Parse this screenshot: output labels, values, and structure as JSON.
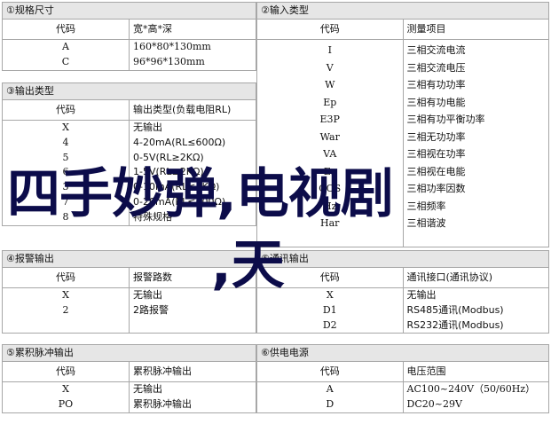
{
  "sections": {
    "s1": {
      "title": "①规格尺寸",
      "col_code": "代码",
      "col_desc": "宽*高*深",
      "rows": [
        [
          "A",
          "160*80*130mm"
        ],
        [
          "C",
          "96*96*130mm"
        ]
      ]
    },
    "s2": {
      "title": "②输入类型",
      "col_code": "代码",
      "col_desc": "测量项目",
      "rows": [
        [
          "I",
          "三相交流电流"
        ],
        [
          "V",
          "三相交流电压"
        ],
        [
          "W",
          "三相有功功率"
        ],
        [
          "Ep",
          "三相有功电能"
        ],
        [
          "E3P",
          "三相有功平衡功率"
        ],
        [
          "War",
          "三相无功功率"
        ],
        [
          "VA",
          "三相视在功率"
        ],
        [
          "Es",
          "三相视在电能"
        ],
        [
          "COS",
          "三相功率因数"
        ],
        [
          "Hz",
          "三相频率"
        ],
        [
          "Har",
          "三相谐波"
        ]
      ]
    },
    "s3": {
      "title": "③输出类型",
      "col_code": "代码",
      "col_desc": "输出类型(负载电阻RL)",
      "rows": [
        [
          "X",
          "无输出"
        ],
        [
          "4",
          "4-20mA(RL≤600Ω)"
        ],
        [
          "5",
          "0-5V(RL≥2KΩ)"
        ],
        [
          "6",
          "1-5V(RL≥2KΩ)"
        ],
        [
          "3",
          "0-10mA(RL≤1KΩ)"
        ],
        [
          "7",
          "0-20mA(RL≤600Ω)"
        ],
        [
          "8",
          "特殊规格"
        ]
      ]
    },
    "s4": {
      "title": "④报警输出",
      "col_code": "代码",
      "col_desc": "报警路数",
      "rows": [
        [
          "X",
          "无输出"
        ],
        [
          "2",
          "2路报警"
        ]
      ]
    },
    "s5": {
      "title": "⑤通讯输出",
      "col_code": "代码",
      "col_desc": "通讯接口(通讯协议)",
      "rows": [
        [
          "X",
          "无输出"
        ],
        [
          "D1",
          "RS485通讯(Modbus)"
        ],
        [
          "D2",
          "RS232通讯(Modbus)"
        ]
      ]
    },
    "s6": {
      "title": "⑤累积脉冲输出",
      "col_code": "代码",
      "col_desc": "累积脉冲输出",
      "rows": [
        [
          "X",
          "无输出"
        ],
        [
          "PO",
          "累积脉冲输出"
        ]
      ]
    },
    "s7": {
      "title": "⑥供电电源",
      "col_code": "代码",
      "col_desc": "电压范围",
      "rows": [
        [
          "A",
          "AC100~240V（50/60Hz）"
        ],
        [
          "D",
          "DC20~29V"
        ]
      ]
    }
  },
  "overlay": {
    "line1": "四手妙弹,电视剧",
    "line2": ",天"
  }
}
